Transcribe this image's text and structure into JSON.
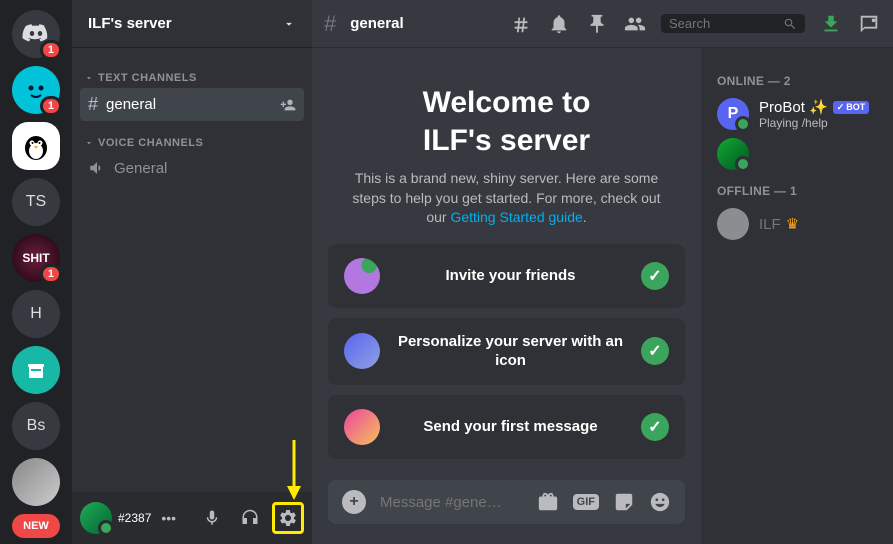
{
  "rail": {
    "home_badge": "1",
    "blue_badge": "1",
    "shit_label": "SHIT",
    "shit_badge": "1",
    "ts_label": "TS",
    "h_label": "H",
    "bs_label": "Bs",
    "new_label": "NEW"
  },
  "server": {
    "name": "ILF's server",
    "text_channels_label": "TEXT CHANNELS",
    "voice_channels_label": "VOICE CHANNELS",
    "text_channel": "general",
    "voice_channel": "General"
  },
  "user_panel": {
    "tag": "#2387"
  },
  "header": {
    "channel": "general",
    "search_placeholder": "Search"
  },
  "welcome": {
    "title_line1": "Welcome to",
    "title_line2": "ILF's server",
    "desc_prefix": "This is a brand new, shiny server. Here are some steps to help you get started. For more, check out our ",
    "guide_link": "Getting Started guide",
    "desc_suffix": ".",
    "card1": "Invite your friends",
    "card2": "Personalize your server with an icon",
    "card3": "Send your first message"
  },
  "composer": {
    "placeholder": "Message #gene…",
    "gif_label": "GIF"
  },
  "members": {
    "online_label": "ONLINE — 2",
    "offline_label": "OFFLINE — 1",
    "probot_name": "ProBot ✨",
    "probot_status": "Playing /help",
    "bot_tag": "BOT",
    "ilf_name": "ILF"
  }
}
